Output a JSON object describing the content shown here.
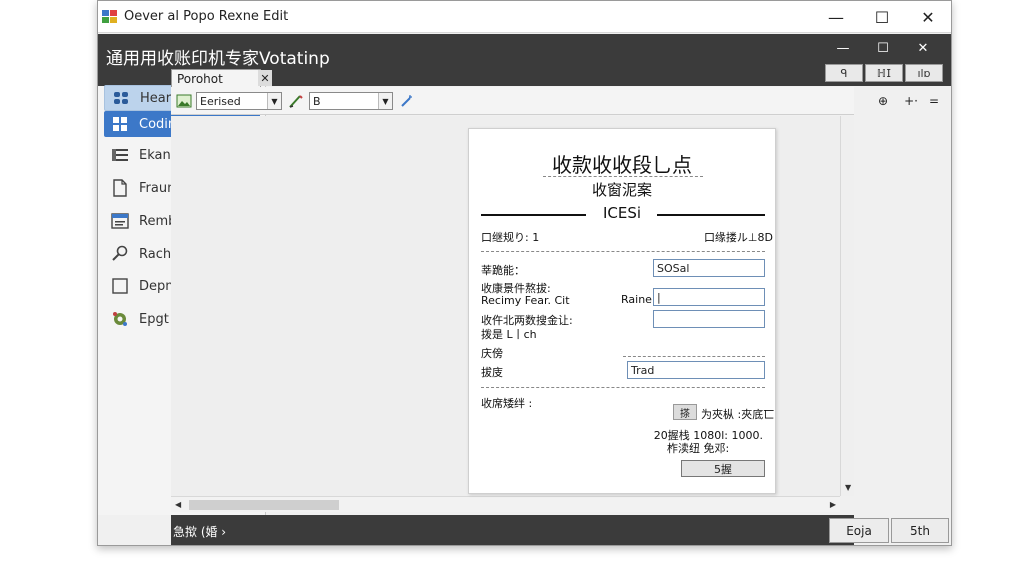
{
  "outer_window": {
    "title": "Oever al Popo Rexne Edit",
    "controls": {
      "minimize": "—",
      "maximize": "☐",
      "close": "✕"
    }
  },
  "inner_window": {
    "title": "通用用收账印机专家Votatinp",
    "controls": {
      "minimize": "—",
      "maximize": "☐",
      "close": "✕"
    },
    "tools": [
      "ᑫ",
      "ℍ𝖨",
      "ılɒ"
    ]
  },
  "sidebar": {
    "items": [
      {
        "label": "Heart",
        "icon": "heart-icon",
        "chevron": ""
      },
      {
        "label": "Codinup",
        "icon": "grid-icon",
        "chevron": ""
      },
      {
        "label": "Ekanhaws",
        "icon": "list-icon",
        "chevron": "›"
      },
      {
        "label": "Fraum Holt",
        "icon": "document-icon",
        "chevron": "›"
      },
      {
        "label": "Rembbtrot",
        "icon": "form-icon",
        "chevron": "›"
      },
      {
        "label": "Rachsinet",
        "icon": "search-icon",
        "chevron": ""
      },
      {
        "label": "Depmiis",
        "icon": "box-icon",
        "extra": "⌗",
        "chevron": "›"
      },
      {
        "label": "Epgt",
        "icon": "gear-icon",
        "chevron": "›"
      }
    ]
  },
  "doc_tab": {
    "label": "Porohot",
    "close": "✕"
  },
  "toolbar": {
    "font_select": "Eerised",
    "size_select": "B",
    "right_icons": [
      "⊕",
      "+·",
      "="
    ]
  },
  "receipt": {
    "title": "收款收收段乚点",
    "subtitle": "收窗泥案",
    "code": "ICESi",
    "row_left": "口继规り: 1",
    "row_right": "口缘搂ル⊥8D",
    "field1_label": "莘跪能：",
    "field1_value": "SOSal",
    "field2_label_line1": "收康景件熬拔:",
    "field2_label_line2": "Recimy Fear. Cit",
    "field2_mid": "Raine",
    "field2_value": "|",
    "field3_label_line1": "收仵北两数搜金让:",
    "field3_label_line2": "拨是        L丨ch",
    "field4_label": "庆傍",
    "field5_label": "拔庋",
    "field5_value": "Trad",
    "section_label": "收席矮绊 :",
    "small_btn": "搽",
    "small_btn_text": "为夾枞 :夾底匸",
    "amount_line1": "20握栈 1080l: 1000.",
    "amount_line2": "柞渎纽 免邓:",
    "confirm_btn": "5握"
  },
  "statusbar": {
    "text": "急揿 (婚 ›",
    "btn1": "Eoja",
    "btn2": "5th"
  },
  "colors": {
    "dark_bar": "#3b3b3b",
    "selection_blue": "#3c78c8",
    "selection_light": "#bcd3ec"
  }
}
